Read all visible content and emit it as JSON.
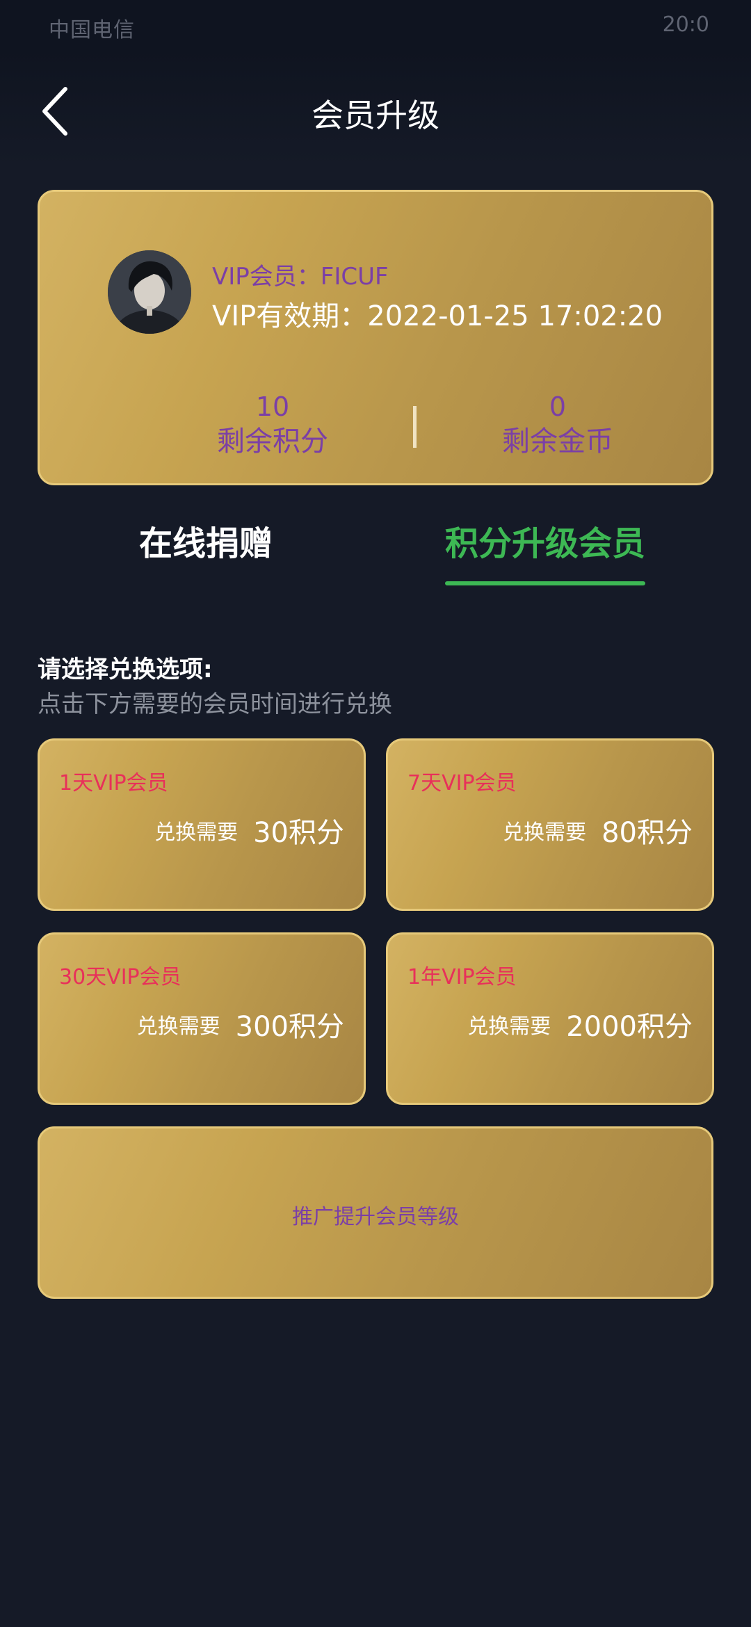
{
  "status_bar": {
    "carrier": "中国电信",
    "time": "20:0"
  },
  "header": {
    "title": "会员升级"
  },
  "profile": {
    "vip_name_label": "VIP会员：",
    "vip_name": "FICUF",
    "expiry_label": "VIP有效期：",
    "expiry_value": "2022-01-25 17:02:20",
    "points_value": "10",
    "points_label": "剩余积分",
    "coins_value": "0",
    "coins_label": "剩余金币"
  },
  "tabs": [
    {
      "label": "在线捐赠",
      "active": false
    },
    {
      "label": "积分升级会员",
      "active": true
    }
  ],
  "prompt": {
    "title": "请选择兑换选项:",
    "subtitle": "点击下方需要的会员时间进行兑换"
  },
  "options": [
    {
      "title": "1天VIP会员",
      "need_label": "兑换需要",
      "cost": "30积分"
    },
    {
      "title": "7天VIP会员",
      "need_label": "兑换需要",
      "cost": "80积分"
    },
    {
      "title": "30天VIP会员",
      "need_label": "兑换需要",
      "cost": "300积分"
    },
    {
      "title": "1年VIP会员",
      "need_label": "兑换需要",
      "cost": "2000积分"
    }
  ],
  "promo": {
    "label": "推广提升会员等级"
  },
  "colors": {
    "background": "#151a27",
    "gold": "#c7a451",
    "accent_green": "#3db854",
    "purple_text": "#7b3fa6",
    "red_text": "#e8305a"
  }
}
